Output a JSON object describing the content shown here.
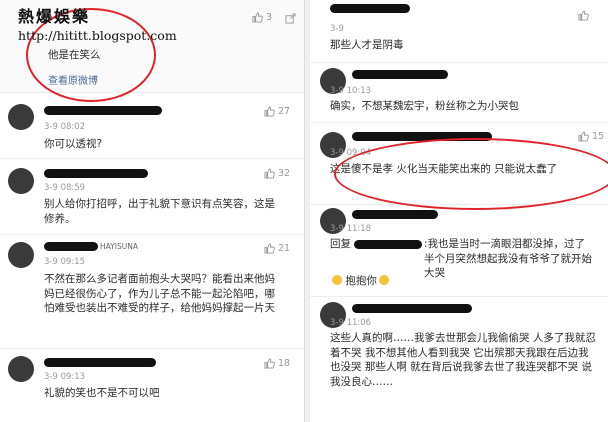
{
  "watermark": {
    "title": "熱爆娛樂",
    "url": "http://hititt.blogspot.com"
  },
  "left": {
    "top_comment": {
      "text": "他是在笑么",
      "likes": "3",
      "link": "查看原微博"
    },
    "comments": [
      {
        "time": "3-9 08:02",
        "text": "你可以透视?",
        "likes": "27"
      },
      {
        "time": "3-9 08:59",
        "text": "别人给你打招呼，出于礼貌下意识有点笑容，这是修养。",
        "likes": "32"
      },
      {
        "username": "HAYISUNA",
        "time": "3-9 09:15",
        "text": "不然在那么多记者面前抱头大哭吗？能看出来他妈妈已经很伤心了，作为儿子总不能一起沦陷吧，哪怕难受也装出不难受的样子，给他妈妈撑起一片天",
        "likes": "21"
      },
      {
        "time": "3-9 09:13",
        "text": "礼貌的笑也不是不可以吧",
        "likes": "18"
      }
    ]
  },
  "right": {
    "comments": [
      {
        "time": "3-9",
        "text": "那些人才是阴毒",
        "likes": ""
      },
      {
        "time": "3-9 10:13",
        "text": "确实，不想某魏宏宇，粉丝称之为小哭包",
        "likes": ""
      },
      {
        "time": "3-9 09:04",
        "text": "这是傻不是孝 火化当天能笑出来的 只能说太蠢了",
        "likes": "15"
      },
      {
        "time": "3-9 11:18",
        "reply_prefix": "回复",
        "text": ":我也是当时一滴眼泪都没掉，过了半个月突然想起我没有爷爷了就开始大哭",
        "text2": "抱抱你",
        "likes": ""
      },
      {
        "time": "3-9 11:06",
        "text": "这些人真的啊……我爹去世那会儿我偷偷哭 人多了我就忍着不哭 我不想其他人看到我哭 它出殡那天我跟在后边我也没哭 那些人啊 就在背后说我爹去世了我连哭都不哭 说我没良心……",
        "likes": ""
      }
    ]
  },
  "colors": {
    "highlight": "#e0222a",
    "link": "#4a6c95",
    "time": "#9a9a9a"
  }
}
